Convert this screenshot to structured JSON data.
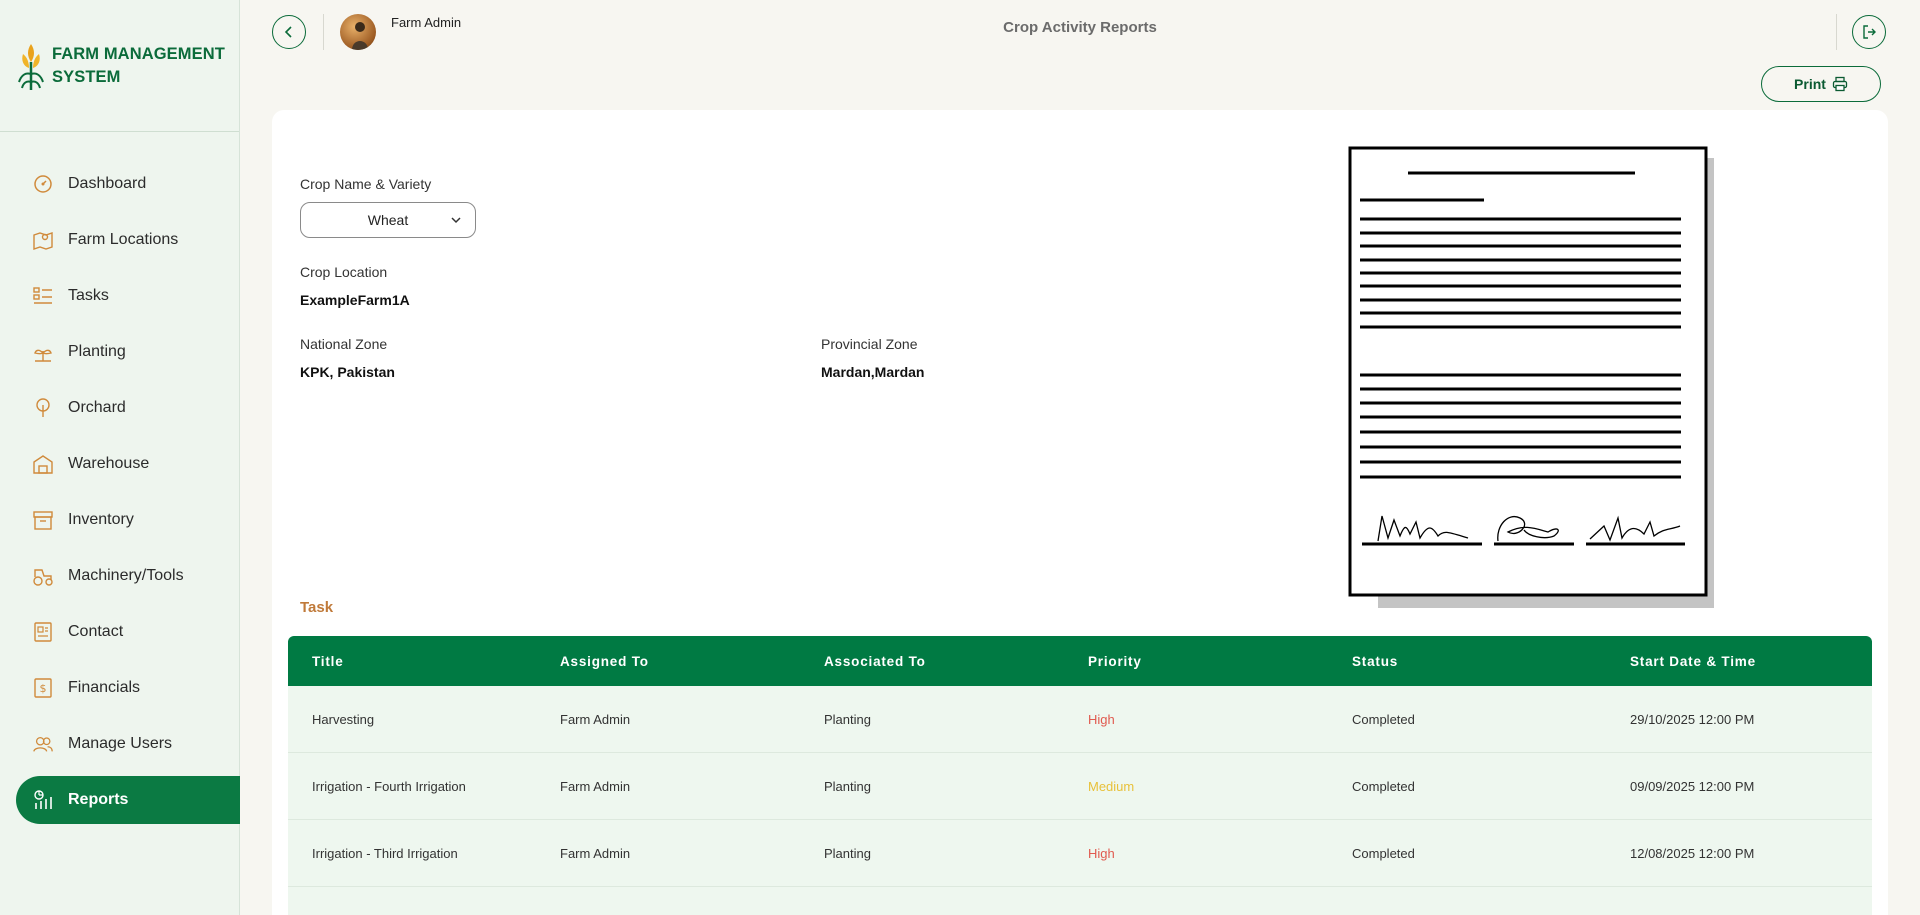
{
  "app": {
    "brand": "FARM MANAGEMENT SYSTEM",
    "brand_line1": "FARM MANAGEMENT",
    "brand_line2": "SYSTEM",
    "accent": "#0b7a43"
  },
  "header": {
    "user_name": "Farm Admin",
    "title": "Crop Activity Reports",
    "print_label": "Print"
  },
  "sidebar": {
    "items": [
      {
        "label": "Dashboard",
        "icon": "dashboard-icon"
      },
      {
        "label": "Farm Locations",
        "icon": "map-icon"
      },
      {
        "label": "Tasks",
        "icon": "tasks-icon"
      },
      {
        "label": "Planting",
        "icon": "plant-icon"
      },
      {
        "label": "Orchard",
        "icon": "tree-icon"
      },
      {
        "label": "Warehouse",
        "icon": "warehouse-icon"
      },
      {
        "label": "Inventory",
        "icon": "box-icon"
      },
      {
        "label": "Machinery/Tools",
        "icon": "tractor-icon"
      },
      {
        "label": "Contact",
        "icon": "contact-icon"
      },
      {
        "label": "Financials",
        "icon": "dollar-icon"
      },
      {
        "label": "Manage Users",
        "icon": "users-icon"
      },
      {
        "label": "Reports",
        "icon": "reports-icon",
        "active": true
      }
    ]
  },
  "report": {
    "crop_label": "Crop Name & Variety",
    "crop_value": "Wheat",
    "location_label": "Crop Location",
    "location_value": "ExampleFarm1A",
    "national_label": "National Zone",
    "national_value": "KPK, Pakistan",
    "provincial_label": "Provincial Zone",
    "provincial_value": "Mardan,Mardan",
    "task_heading": "Task"
  },
  "table": {
    "columns": [
      "Title",
      "Assigned To",
      "Associated To",
      "Priority",
      "Status",
      "Start Date & Time"
    ],
    "rows": [
      [
        "Harvesting",
        "Farm Admin",
        "Planting",
        "High",
        "Completed",
        "29/10/2025 12:00 PM"
      ],
      [
        "Irrigation - Fourth Irrigation",
        "Farm Admin",
        "Planting",
        "Medium",
        "Completed",
        "09/09/2025 12:00 PM"
      ],
      [
        "Irrigation - Third Irrigation",
        "Farm Admin",
        "Planting",
        "High",
        "Completed",
        "12/08/2025 12:00 PM"
      ]
    ],
    "priority_colors": {
      "High": "#e05a4f",
      "Medium": "#e8c13a"
    }
  }
}
